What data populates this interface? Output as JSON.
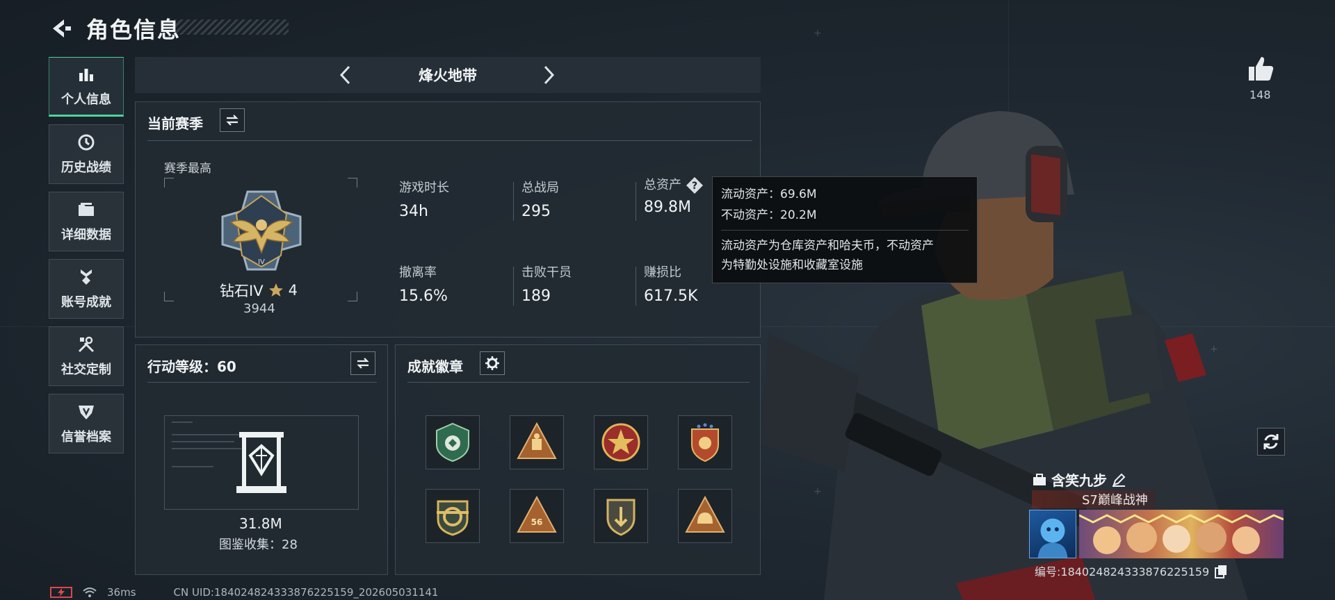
{
  "header": {
    "title": "角色信息"
  },
  "sidebar": {
    "items": [
      {
        "label": "个人信息",
        "icon": "bar-chart-icon",
        "active": true
      },
      {
        "label": "历史战绩",
        "icon": "clock-icon"
      },
      {
        "label": "详细数据",
        "icon": "folder-icon"
      },
      {
        "label": "账号成就",
        "icon": "medal-icon"
      },
      {
        "label": "社交定制",
        "icon": "tools-icon"
      },
      {
        "label": "信誉档案",
        "icon": "shield-icon"
      }
    ]
  },
  "mode": {
    "title": "烽火地带"
  },
  "season": {
    "title": "当前赛季",
    "best_label": "赛季最高",
    "rank_name": "钻石IV",
    "rank_stars": "4",
    "rank_score": "3944",
    "stats": [
      {
        "label": "游戏时长",
        "value": "34h"
      },
      {
        "label": "总战局",
        "value": "295"
      },
      {
        "label": "总资产",
        "value": "89.8M"
      },
      {
        "label": "撤离率",
        "value": "15.6%"
      },
      {
        "label": "击败干员",
        "value": "189"
      },
      {
        "label": "赚损比",
        "value": "617.5K"
      }
    ]
  },
  "tooltip": {
    "liquid": "流动资产：69.6M",
    "fixed": "不动资产：20.2M",
    "description_line1": "流动资产为仓库资产和哈夫币，不动资产",
    "description_line2": "为特勤处设施和收藏室设施"
  },
  "operation": {
    "title": "行动等级：60",
    "value": "31.8M",
    "collection": "图鉴收集：28"
  },
  "achievements": {
    "title": "成就徽章",
    "badges": [
      "badge-shield-green",
      "badge-triangle-robot",
      "badge-star-red",
      "badge-shield-stars",
      "badge-crest-gold",
      "badge-triangle-56",
      "badge-shield-arrow",
      "badge-triangle-helmet"
    ]
  },
  "profile": {
    "likes": "148",
    "name": "含笑九步",
    "title": "S7巅峰战神",
    "uid": "编号:184024824333876225159"
  },
  "footer": {
    "ping": "36ms",
    "uid": "CN UID:184024824333876225159_202605031141"
  },
  "colors": {
    "accent": "#4fd39a",
    "panel": "#222a32",
    "background": "#1c242d"
  }
}
